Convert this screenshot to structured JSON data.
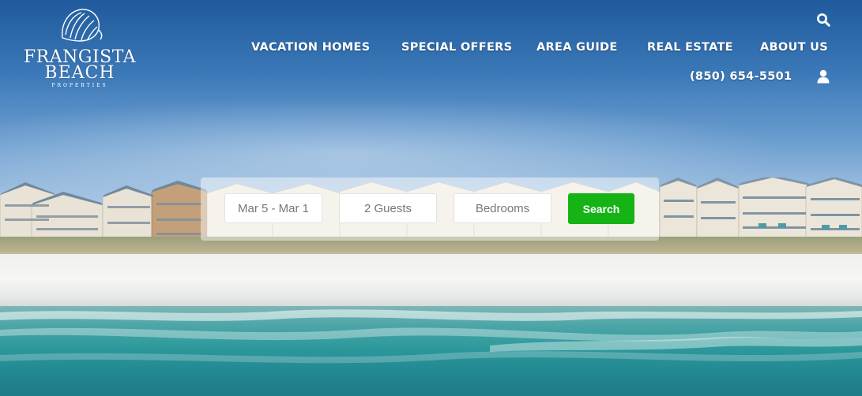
{
  "brand": {
    "line1": "FRANGISTA",
    "line2": "BEACH",
    "line3": "PROPERTIES"
  },
  "nav": {
    "items": [
      {
        "label": "VACATION HOMES"
      },
      {
        "label": "SPECIAL OFFERS"
      },
      {
        "label": "AREA GUIDE"
      },
      {
        "label": "REAL ESTATE"
      },
      {
        "label": "ABOUT US"
      }
    ],
    "phone": "(850) 654-5501"
  },
  "search": {
    "dates": "Mar 5 - Mar 1",
    "guests": "2 Guests",
    "bedrooms": "Bedrooms",
    "button_label": "Search"
  },
  "colors": {
    "accent_green": "#16b316",
    "nav_text": "#ffffff"
  },
  "icons": {
    "search": "search-icon",
    "user": "user-icon",
    "logo": "seashell-icon"
  }
}
